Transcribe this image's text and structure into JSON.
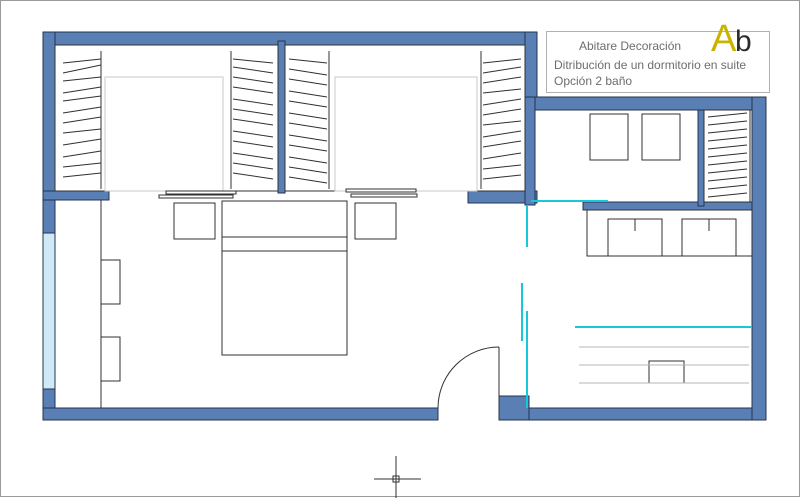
{
  "title_block": {
    "brand": "Abitare Decoración",
    "logo_a": "A",
    "logo_b": "b",
    "line1": "Ditribución de un dormitorio en suite",
    "line2": "Opción 2 baño"
  },
  "colors": {
    "wall_fill": "#5a7fb5",
    "wall_stroke": "#24344e",
    "line": "#303030",
    "cyan": "#19c8d8",
    "glass": "#cfeaf6"
  }
}
